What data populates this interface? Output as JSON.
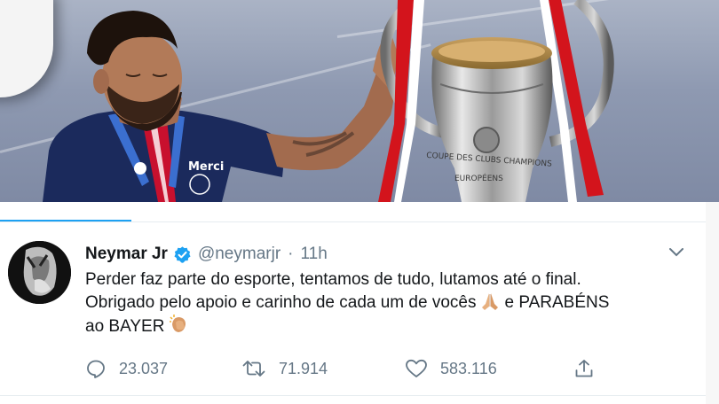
{
  "photo": {
    "shirt_text": "Merci",
    "trophy_engraving": [
      "COUPE DES CLUBS CHAMPIONS",
      "EUROPÉENS"
    ]
  },
  "tweet": {
    "author_name": "Neymar Jr",
    "handle": "@neymarjr",
    "separator": "·",
    "time": "11h",
    "text_line1": "Perder faz parte do esporte, tentamos de tudo, lutamos até o final.",
    "text_line2_a": "Obrigado pelo apoio e carinho de cada um de vocês",
    "text_line2_b": "e PARABÉNS",
    "text_line3": "ao BAYER",
    "emoji_1": "praying-hands-icon",
    "emoji_2": "clapping-hands-icon",
    "reply_count": "23.037",
    "retweet_count": "71.914",
    "like_count": "583.116"
  },
  "colors": {
    "accent": "#1da1f2",
    "secondary_text": "#657786",
    "primary_text": "#14171a",
    "psg_navy": "#1b2a5c"
  }
}
